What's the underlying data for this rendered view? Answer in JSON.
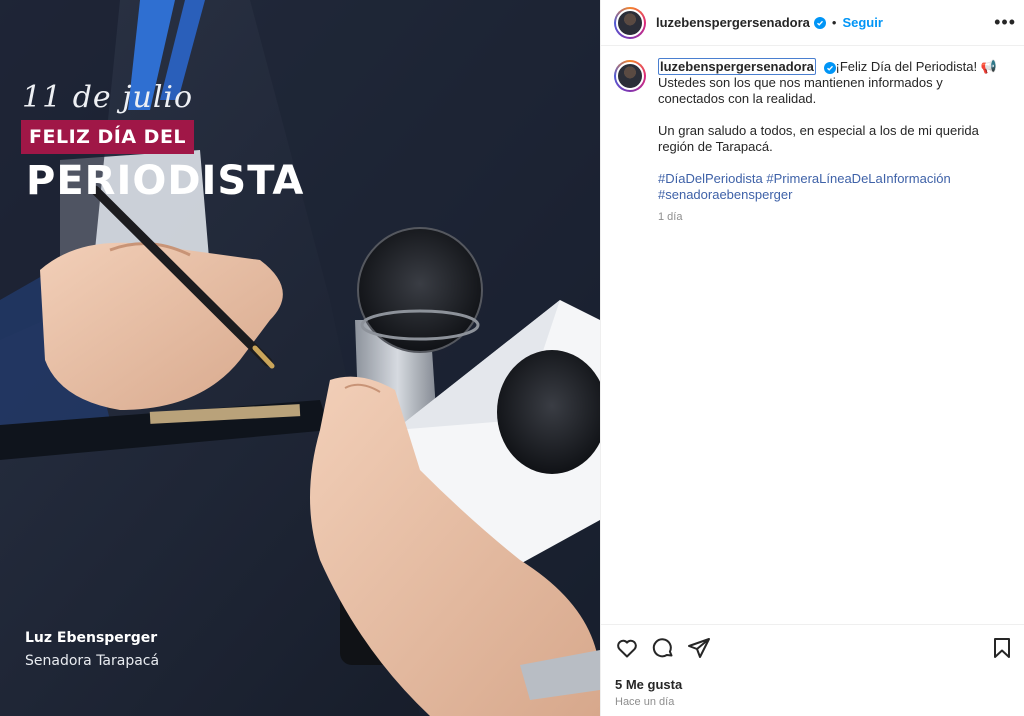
{
  "post_image": {
    "date_text": "11 de julio",
    "tag_text": "FELIZ DÍA DEL",
    "headline": "PERIODISTA",
    "signature_name": "Luz Ebensperger",
    "signature_role": "Senadora Tarapacá"
  },
  "header": {
    "username": "luzebenspergersenadora",
    "separator": "•",
    "follow_label": "Seguir",
    "more_label": "•••"
  },
  "caption": {
    "username": "luzebenspergersenadora",
    "line1": "¡Feliz Día del Periodista! 📢",
    "line2": "Ustedes son los que nos mantienen informados y conectados con la realidad.",
    "line3": "Un gran saludo a todos, en especial a los de mi querida región de Tarapacá.",
    "hashtags": [
      "#DíaDelPeriodista",
      "#PrimeraLíneaDeLaInformación",
      "#senadoraebensperger"
    ],
    "time": "1 día"
  },
  "engagement": {
    "likes": "5 Me gusta",
    "posted": "Hace un día"
  },
  "colors": {
    "accent": "#0095f6",
    "tag_bg": "#a01747",
    "hashtag": "#3f62a8"
  },
  "icons": [
    "heart-icon",
    "comment-icon",
    "share-icon",
    "bookmark-icon",
    "verified-icon",
    "more-icon"
  ]
}
